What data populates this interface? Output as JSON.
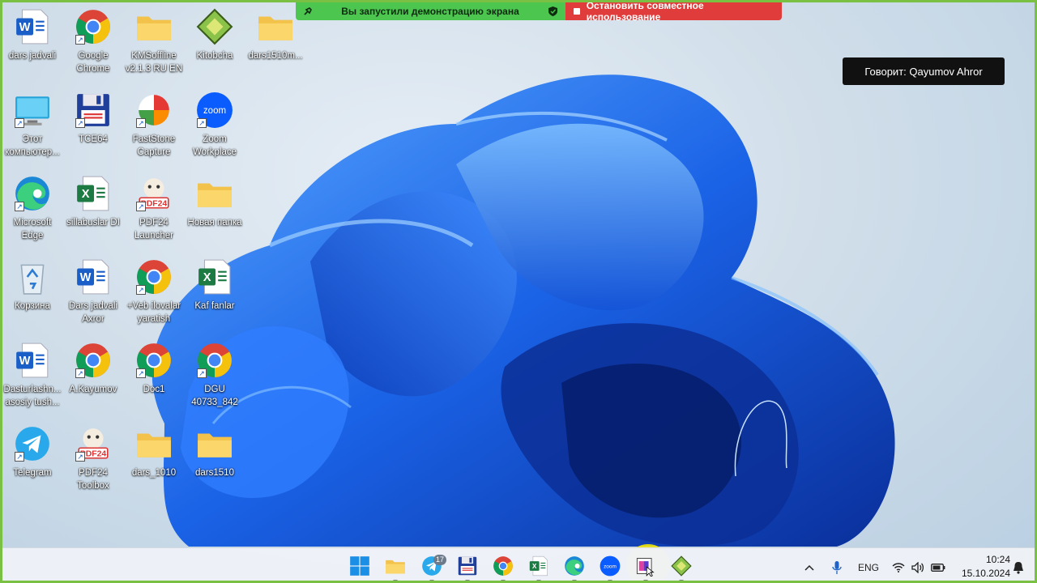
{
  "share_banner": {
    "status_text": "Вы запустили демонстрацию экрана",
    "stop_text": "Остановить совместное использование"
  },
  "speaker_label": "Говорит: Qayumov Ahror",
  "desktop_icons": [
    {
      "label": "dars jadvali",
      "icon": "word-icon"
    },
    {
      "label": "Google Chrome",
      "icon": "chrome-icon"
    },
    {
      "label": "KMSoffline v2.1.3 RU EN",
      "icon": "folder-icon"
    },
    {
      "label": "Kitobcha",
      "icon": "book-icon"
    },
    {
      "label": "dars1510m...",
      "icon": "folder-icon"
    },
    {
      "label": "Этот компьютер...",
      "icon": "computer-icon"
    },
    {
      "label": "TCE64",
      "icon": "floppy-icon"
    },
    {
      "label": "FastStone Capture",
      "icon": "faststone-icon"
    },
    {
      "label": "Zoom Workplace",
      "icon": "zoom-icon"
    },
    {
      "label": "Microsoft Edge",
      "icon": "edge-icon"
    },
    {
      "label": "sillabuslar DI",
      "icon": "excel-icon"
    },
    {
      "label": "PDF24 Launcher",
      "icon": "pdf24-icon"
    },
    {
      "label": "Новая папка",
      "icon": "folder-icon"
    },
    {
      "label": "Корзина",
      "icon": "recycle-bin-icon"
    },
    {
      "label": "Dars jadvali Axror",
      "icon": "word-icon"
    },
    {
      "label": "+Veb ilovalar yaratish",
      "icon": "chrome-icon"
    },
    {
      "label": "Kaf fanlar",
      "icon": "excel-icon"
    },
    {
      "label": "Dasturlashn... asosiy tush...",
      "icon": "word-icon"
    },
    {
      "label": "A.Kayumov",
      "icon": "chrome-icon"
    },
    {
      "label": "Doc1",
      "icon": "chrome-icon"
    },
    {
      "label": "DGU 40733_842",
      "icon": "chrome-icon"
    },
    {
      "label": "Telegram",
      "icon": "telegram-icon"
    },
    {
      "label": "PDF24 Toolbox",
      "icon": "pdf24-icon"
    },
    {
      "label": "dars_1010",
      "icon": "folder-icon"
    },
    {
      "label": "dars1510",
      "icon": "folder-icon"
    }
  ],
  "taskbar": {
    "apps": [
      {
        "name": "start-button",
        "icon": "windows-icon"
      },
      {
        "name": "file-explorer",
        "icon": "folder-icon"
      },
      {
        "name": "telegram",
        "icon": "telegram-icon",
        "badge": "17"
      },
      {
        "name": "tce64",
        "icon": "floppy-icon"
      },
      {
        "name": "chrome",
        "icon": "chrome-icon"
      },
      {
        "name": "excel",
        "icon": "excel-icon"
      },
      {
        "name": "edge",
        "icon": "edge-icon"
      },
      {
        "name": "zoom",
        "icon": "zoom-icon"
      },
      {
        "name": "paint-app",
        "icon": "paint-icon"
      },
      {
        "name": "kitobcha",
        "icon": "book-icon"
      }
    ],
    "tray": {
      "language": "ENG",
      "time": "10:24",
      "date": "15.10.2024"
    }
  },
  "colors": {
    "screen_share_green": "#4cc64f",
    "stop_red": "#e03c3c",
    "wallpaper_blue": "#1a5fd8",
    "border_green": "#7ac043"
  }
}
